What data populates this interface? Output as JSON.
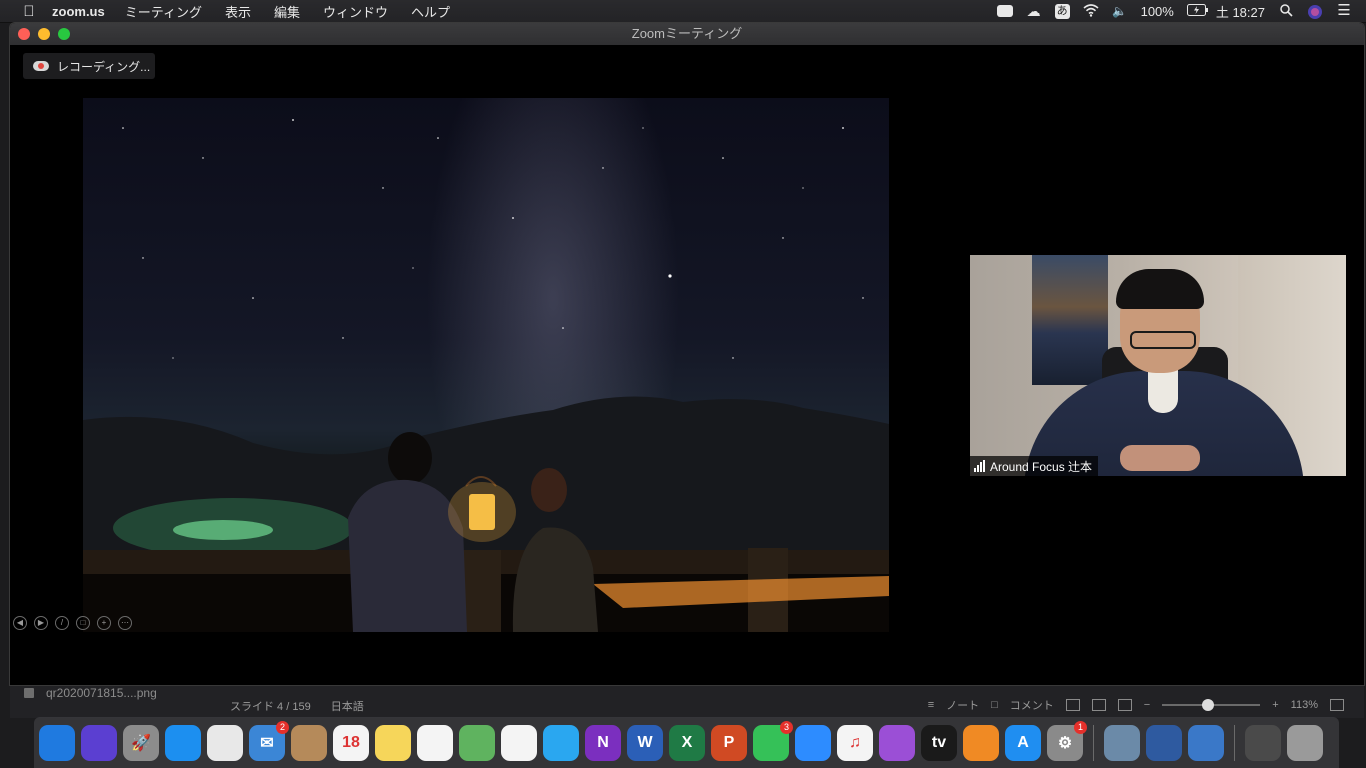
{
  "menubar": {
    "apple_icon": "apple-logo-icon",
    "app_name": "zoom.us",
    "menus": [
      "ミーティング",
      "表示",
      "編集",
      "ウィンドウ",
      "ヘルプ"
    ],
    "status_icons": [
      "zoom-camera-icon",
      "icloud-icon",
      "input-method-icon",
      "wifi-icon",
      "volume-icon"
    ],
    "ime_glyph": "あ",
    "battery": "100%",
    "clock": "土 18:27",
    "right_icons": [
      "spotlight-icon",
      "siri-icon",
      "control-center-icon"
    ]
  },
  "window": {
    "title": "Zoomミーティング",
    "recording_label": "レコーディング..."
  },
  "video": {
    "participant_name": "Around Focus 辻本"
  },
  "presentation": {
    "file_name": "qr2020071815....png",
    "slide_status": "スライド 4 / 159",
    "language": "日本語",
    "notes_label": "ノート",
    "comments_label": "コメント",
    "zoom_value": "113%",
    "zoom_fraction": 0.46
  },
  "dock": {
    "items": [
      {
        "name": "finder",
        "color": "#1f7ae0",
        "glyph": ""
      },
      {
        "name": "siri",
        "color": "#5b3fd1",
        "glyph": ""
      },
      {
        "name": "launchpad",
        "color": "#8c8c8c",
        "glyph": "🚀"
      },
      {
        "name": "safari",
        "color": "#1c8ff0",
        "glyph": ""
      },
      {
        "name": "chrome",
        "color": "#e8e8e8",
        "glyph": ""
      },
      {
        "name": "mail",
        "color": "#3b86d6",
        "glyph": "✉",
        "badge": "2"
      },
      {
        "name": "contacts",
        "color": "#b58a5a",
        "glyph": ""
      },
      {
        "name": "calendar",
        "color": "#f4f4f4",
        "glyph": "18"
      },
      {
        "name": "notes",
        "color": "#f6d65a",
        "glyph": ""
      },
      {
        "name": "reminders",
        "color": "#f4f4f4",
        "glyph": ""
      },
      {
        "name": "maps",
        "color": "#5fb35f",
        "glyph": ""
      },
      {
        "name": "photos",
        "color": "#f4f4f4",
        "glyph": ""
      },
      {
        "name": "messages",
        "color": "#2aa7f0",
        "glyph": ""
      },
      {
        "name": "onenote",
        "color": "#7b2fbf",
        "glyph": "N"
      },
      {
        "name": "word",
        "color": "#2b5fb7",
        "glyph": "W"
      },
      {
        "name": "excel",
        "color": "#1f7a45",
        "glyph": "X"
      },
      {
        "name": "powerpoint",
        "color": "#d04a23",
        "glyph": "P"
      },
      {
        "name": "facetime",
        "color": "#35c158",
        "glyph": "",
        "badge": "3"
      },
      {
        "name": "zoom",
        "color": "#2d8cff",
        "glyph": ""
      },
      {
        "name": "music",
        "color": "#f4f4f4",
        "glyph": "♫"
      },
      {
        "name": "podcasts",
        "color": "#9b4fd6",
        "glyph": ""
      },
      {
        "name": "apple-tv",
        "color": "#1a1a1a",
        "glyph": "tv"
      },
      {
        "name": "books",
        "color": "#f08a24",
        "glyph": ""
      },
      {
        "name": "app-store",
        "color": "#1f8ef1",
        "glyph": "A"
      },
      {
        "name": "system-preferences",
        "color": "#8a8a8a",
        "glyph": "⚙",
        "badge": "1"
      },
      {
        "name": "preview",
        "color": "#6b8aa8",
        "glyph": ""
      },
      {
        "name": "screen-app",
        "color": "#2e5aa0",
        "glyph": ""
      },
      {
        "name": "keynote-chart",
        "color": "#3a78c8",
        "glyph": ""
      },
      {
        "name": "downloads",
        "color": "#4a4a4a",
        "glyph": ""
      },
      {
        "name": "trash",
        "color": "#9a9a9a",
        "glyph": ""
      }
    ]
  }
}
